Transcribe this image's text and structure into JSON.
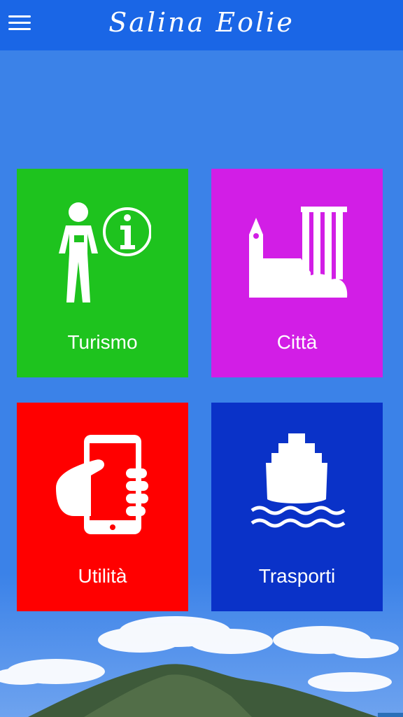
{
  "app": {
    "title": "Salina Eolie"
  },
  "header": {
    "menu_icon": "hamburger-menu-icon"
  },
  "tiles": [
    {
      "label": "Turismo",
      "icon": "tourist-info-icon",
      "color": "#1ec31e"
    },
    {
      "label": "Città",
      "icon": "city-buildings-icon",
      "color": "#d21ee6"
    },
    {
      "label": "Utilità",
      "icon": "smartphone-hand-icon",
      "color": "#ff0000"
    },
    {
      "label": "Trasporti",
      "icon": "ferry-ship-icon",
      "color": "#0a32c8"
    }
  ],
  "background": {
    "sky_color": "#3b82e8",
    "header_color": "#1a66e6"
  }
}
